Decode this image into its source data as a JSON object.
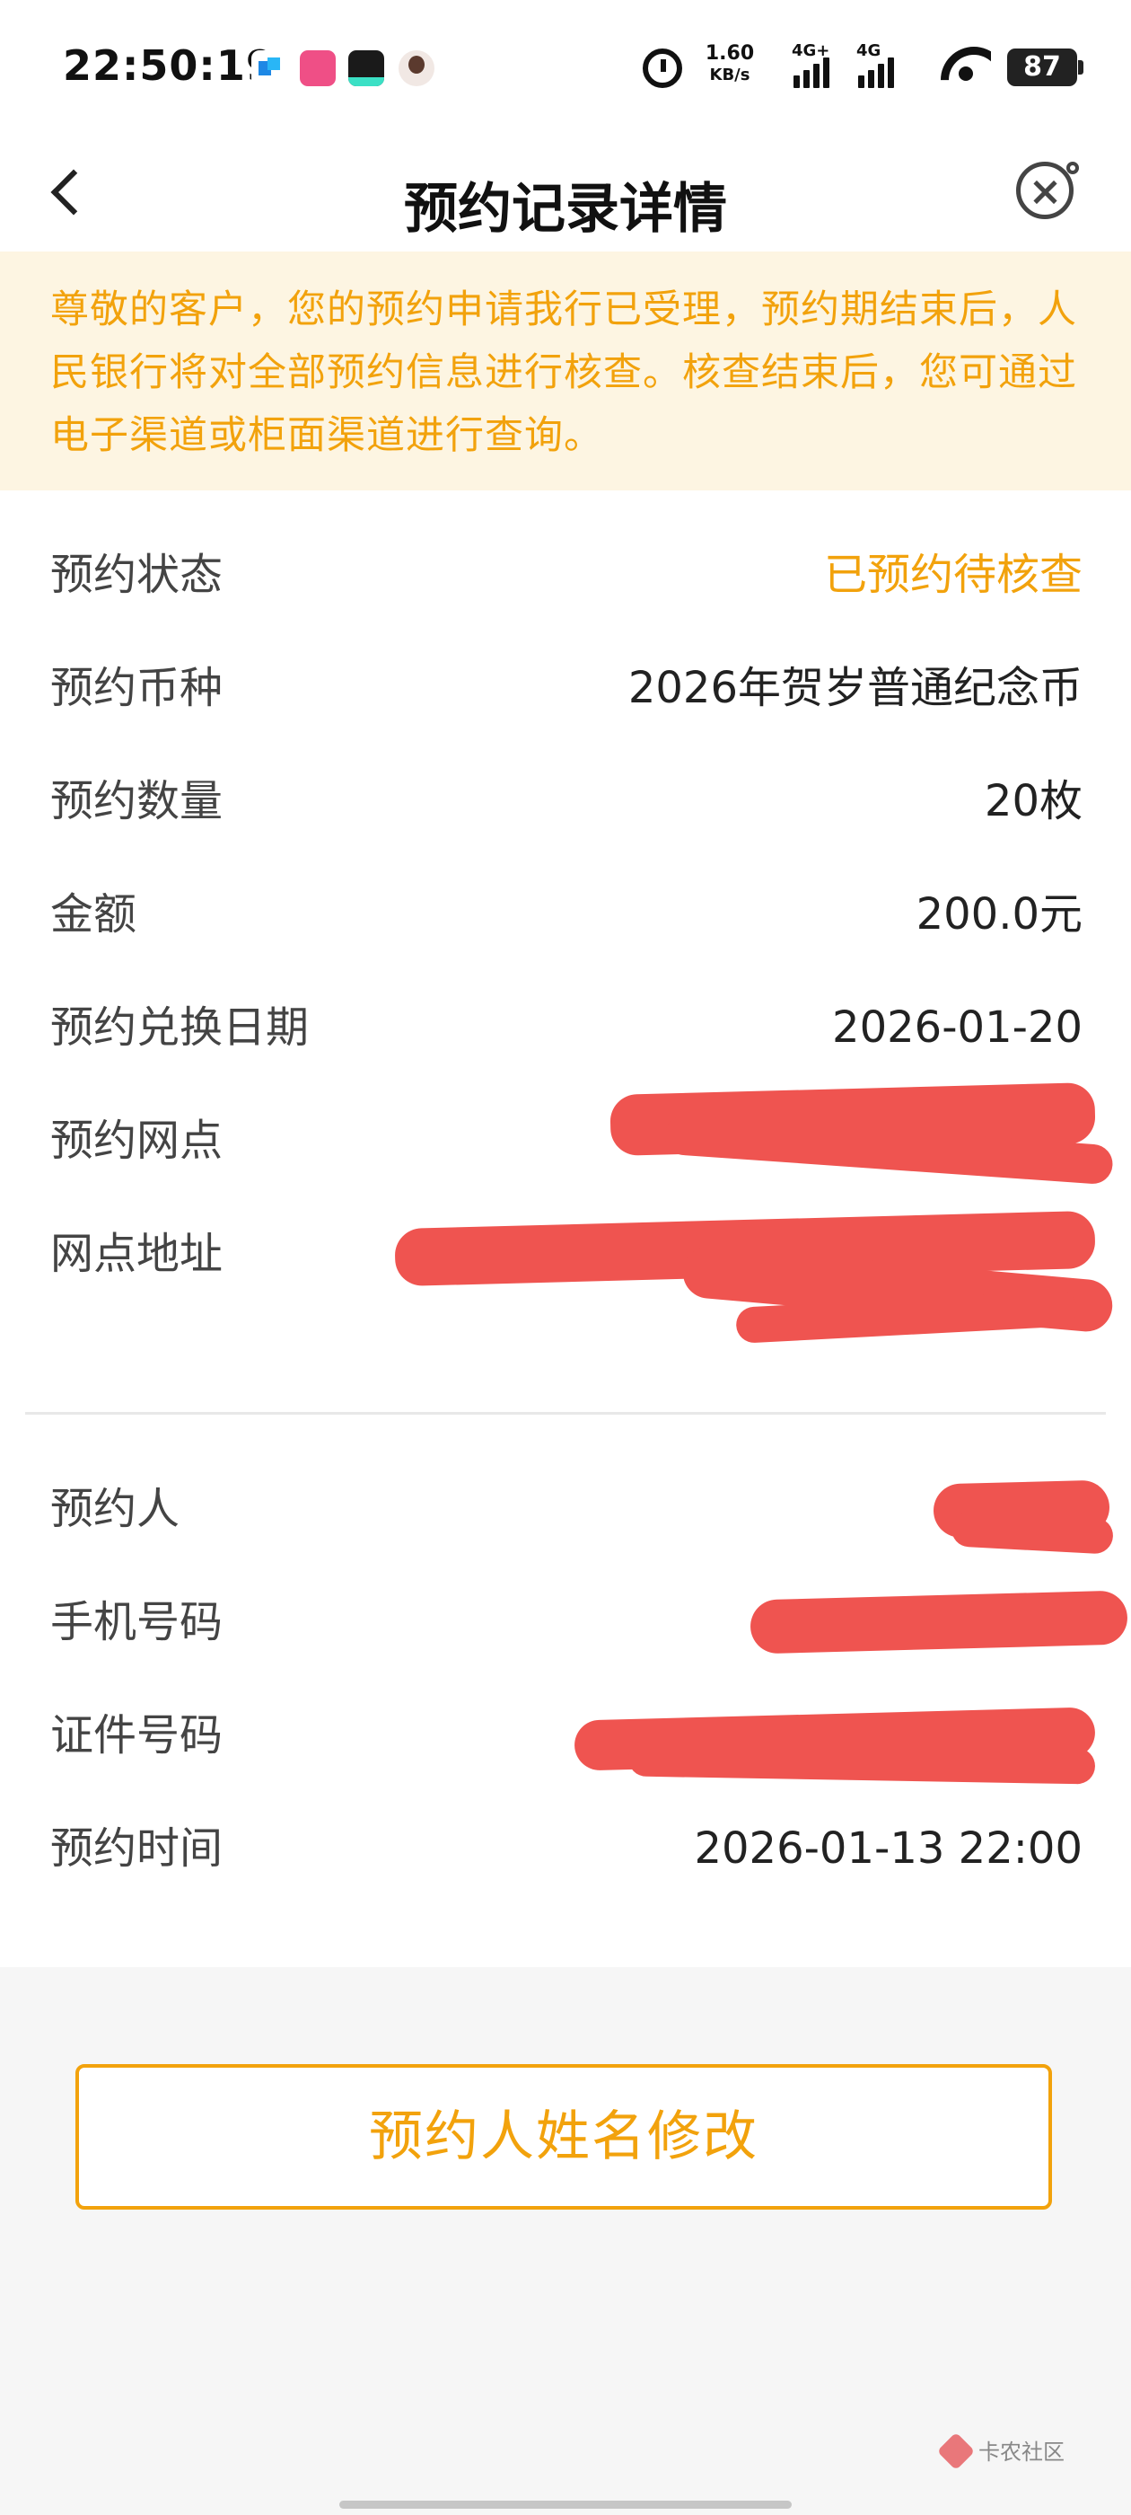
{
  "status_bar": {
    "time": "22:50:19",
    "net_speed_value": "1.60",
    "net_speed_unit": "KB/s",
    "signal1_label": "4G+",
    "signal2_label": "4G",
    "battery": "87"
  },
  "nav": {
    "title": "预约记录详情"
  },
  "notice": {
    "text": "尊敬的客户，您的预约申请我行已受理，预约期结束后，人民银行将对全部预约信息进行核查。核查结束后，您可通过电子渠道或柜面渠道进行查询。"
  },
  "details": [
    {
      "label": "预约状态",
      "value": "已预约待核查"
    },
    {
      "label": "预约币种",
      "value": "2026年贺岁普通纪念币"
    },
    {
      "label": "预约数量",
      "value": "20枚"
    },
    {
      "label": "金额",
      "value": "200.0元"
    },
    {
      "label": "预约兑换日期",
      "value": "2026-01-20"
    },
    {
      "label": "预约网点",
      "value": ""
    },
    {
      "label": "网点地址",
      "value": ""
    }
  ],
  "personal": [
    {
      "label": "预约人",
      "value": ""
    },
    {
      "label": "手机号码",
      "value": ""
    },
    {
      "label": "证件号码",
      "value": ""
    },
    {
      "label": "预约时间",
      "value": "2026-01-13 22:00"
    }
  ],
  "actions": {
    "modify_name": "预约人姓名修改"
  },
  "watermark": {
    "text": "卡农社区"
  },
  "colors": {
    "accent": "#f2a20c",
    "notice_bg": "#fdf5e2",
    "redaction": "#ef5450"
  }
}
